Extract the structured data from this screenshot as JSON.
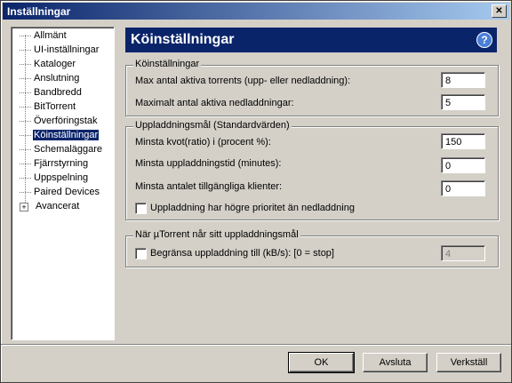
{
  "window": {
    "title": "Inställningar",
    "close_glyph": "✕"
  },
  "tree": {
    "items": [
      {
        "label": "Allmänt"
      },
      {
        "label": "UI-inställningar"
      },
      {
        "label": "Kataloger"
      },
      {
        "label": "Anslutning"
      },
      {
        "label": "Bandbredd"
      },
      {
        "label": "BitTorrent"
      },
      {
        "label": "Överföringstak"
      },
      {
        "label": "Köinställningar"
      },
      {
        "label": "Schemaläggare"
      },
      {
        "label": "Fjärrstyrning"
      },
      {
        "label": "Uppspelning"
      },
      {
        "label": "Paired Devices"
      },
      {
        "label": "Avancerat"
      }
    ],
    "expander_glyph": "+"
  },
  "header": {
    "title": "Köinställningar",
    "help_glyph": "?"
  },
  "queue": {
    "legend": "Köinställningar",
    "max_active_label": "Max antal aktiva torrents (upp- eller nedladdning):",
    "max_active_value": "8",
    "max_downloads_label": "Maximalt antal aktiva nedladdningar:",
    "max_downloads_value": "5"
  },
  "seeding": {
    "legend": "Uppladdningsmål (Standardvärden)",
    "min_ratio_label": "Minsta kvot(ratio) i (procent %):",
    "min_ratio_value": "150",
    "min_time_label": "Minsta uppladdningstid (minutes):",
    "min_time_value": "0",
    "min_seeds_label": "Minsta antalet tillgängliga klienter:",
    "min_seeds_value": "0",
    "priority_label": "Uppladdning har högre prioritet än nedladdning"
  },
  "goal": {
    "legend": "När µTorrent når sitt uppladdningsmål",
    "limit_label": "Begränsa uppladdning till (kB/s): [0 = stop]",
    "limit_value": "4"
  },
  "buttons": {
    "ok": "OK",
    "cancel": "Avsluta",
    "apply": "Verkställ"
  }
}
